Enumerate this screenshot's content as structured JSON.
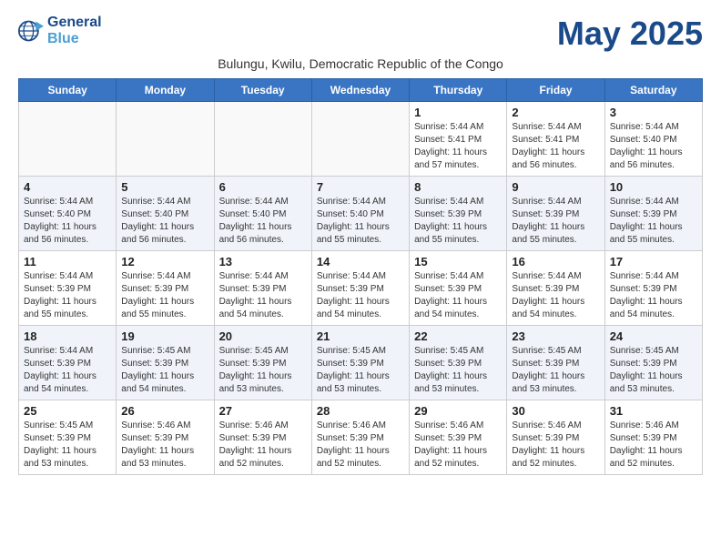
{
  "logo": {
    "line1": "General",
    "line2": "Blue"
  },
  "title": "May 2025",
  "subtitle": "Bulungu, Kwilu, Democratic Republic of the Congo",
  "days_of_week": [
    "Sunday",
    "Monday",
    "Tuesday",
    "Wednesday",
    "Thursday",
    "Friday",
    "Saturday"
  ],
  "weeks": [
    [
      {
        "day": "",
        "info": ""
      },
      {
        "day": "",
        "info": ""
      },
      {
        "day": "",
        "info": ""
      },
      {
        "day": "",
        "info": ""
      },
      {
        "day": "1",
        "info": "Sunrise: 5:44 AM\nSunset: 5:41 PM\nDaylight: 11 hours\nand 57 minutes."
      },
      {
        "day": "2",
        "info": "Sunrise: 5:44 AM\nSunset: 5:41 PM\nDaylight: 11 hours\nand 56 minutes."
      },
      {
        "day": "3",
        "info": "Sunrise: 5:44 AM\nSunset: 5:40 PM\nDaylight: 11 hours\nand 56 minutes."
      }
    ],
    [
      {
        "day": "4",
        "info": "Sunrise: 5:44 AM\nSunset: 5:40 PM\nDaylight: 11 hours\nand 56 minutes."
      },
      {
        "day": "5",
        "info": "Sunrise: 5:44 AM\nSunset: 5:40 PM\nDaylight: 11 hours\nand 56 minutes."
      },
      {
        "day": "6",
        "info": "Sunrise: 5:44 AM\nSunset: 5:40 PM\nDaylight: 11 hours\nand 56 minutes."
      },
      {
        "day": "7",
        "info": "Sunrise: 5:44 AM\nSunset: 5:40 PM\nDaylight: 11 hours\nand 55 minutes."
      },
      {
        "day": "8",
        "info": "Sunrise: 5:44 AM\nSunset: 5:39 PM\nDaylight: 11 hours\nand 55 minutes."
      },
      {
        "day": "9",
        "info": "Sunrise: 5:44 AM\nSunset: 5:39 PM\nDaylight: 11 hours\nand 55 minutes."
      },
      {
        "day": "10",
        "info": "Sunrise: 5:44 AM\nSunset: 5:39 PM\nDaylight: 11 hours\nand 55 minutes."
      }
    ],
    [
      {
        "day": "11",
        "info": "Sunrise: 5:44 AM\nSunset: 5:39 PM\nDaylight: 11 hours\nand 55 minutes."
      },
      {
        "day": "12",
        "info": "Sunrise: 5:44 AM\nSunset: 5:39 PM\nDaylight: 11 hours\nand 55 minutes."
      },
      {
        "day": "13",
        "info": "Sunrise: 5:44 AM\nSunset: 5:39 PM\nDaylight: 11 hours\nand 54 minutes."
      },
      {
        "day": "14",
        "info": "Sunrise: 5:44 AM\nSunset: 5:39 PM\nDaylight: 11 hours\nand 54 minutes."
      },
      {
        "day": "15",
        "info": "Sunrise: 5:44 AM\nSunset: 5:39 PM\nDaylight: 11 hours\nand 54 minutes."
      },
      {
        "day": "16",
        "info": "Sunrise: 5:44 AM\nSunset: 5:39 PM\nDaylight: 11 hours\nand 54 minutes."
      },
      {
        "day": "17",
        "info": "Sunrise: 5:44 AM\nSunset: 5:39 PM\nDaylight: 11 hours\nand 54 minutes."
      }
    ],
    [
      {
        "day": "18",
        "info": "Sunrise: 5:44 AM\nSunset: 5:39 PM\nDaylight: 11 hours\nand 54 minutes."
      },
      {
        "day": "19",
        "info": "Sunrise: 5:45 AM\nSunset: 5:39 PM\nDaylight: 11 hours\nand 54 minutes."
      },
      {
        "day": "20",
        "info": "Sunrise: 5:45 AM\nSunset: 5:39 PM\nDaylight: 11 hours\nand 53 minutes."
      },
      {
        "day": "21",
        "info": "Sunrise: 5:45 AM\nSunset: 5:39 PM\nDaylight: 11 hours\nand 53 minutes."
      },
      {
        "day": "22",
        "info": "Sunrise: 5:45 AM\nSunset: 5:39 PM\nDaylight: 11 hours\nand 53 minutes."
      },
      {
        "day": "23",
        "info": "Sunrise: 5:45 AM\nSunset: 5:39 PM\nDaylight: 11 hours\nand 53 minutes."
      },
      {
        "day": "24",
        "info": "Sunrise: 5:45 AM\nSunset: 5:39 PM\nDaylight: 11 hours\nand 53 minutes."
      }
    ],
    [
      {
        "day": "25",
        "info": "Sunrise: 5:45 AM\nSunset: 5:39 PM\nDaylight: 11 hours\nand 53 minutes."
      },
      {
        "day": "26",
        "info": "Sunrise: 5:46 AM\nSunset: 5:39 PM\nDaylight: 11 hours\nand 53 minutes."
      },
      {
        "day": "27",
        "info": "Sunrise: 5:46 AM\nSunset: 5:39 PM\nDaylight: 11 hours\nand 52 minutes."
      },
      {
        "day": "28",
        "info": "Sunrise: 5:46 AM\nSunset: 5:39 PM\nDaylight: 11 hours\nand 52 minutes."
      },
      {
        "day": "29",
        "info": "Sunrise: 5:46 AM\nSunset: 5:39 PM\nDaylight: 11 hours\nand 52 minutes."
      },
      {
        "day": "30",
        "info": "Sunrise: 5:46 AM\nSunset: 5:39 PM\nDaylight: 11 hours\nand 52 minutes."
      },
      {
        "day": "31",
        "info": "Sunrise: 5:46 AM\nSunset: 5:39 PM\nDaylight: 11 hours\nand 52 minutes."
      }
    ]
  ]
}
